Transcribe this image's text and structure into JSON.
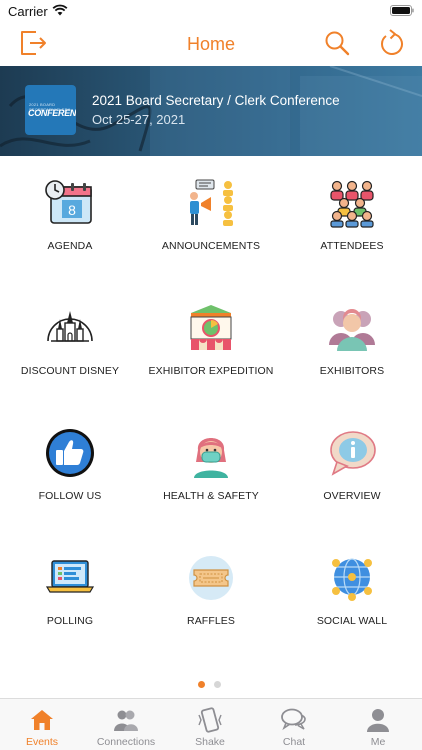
{
  "status_bar": {
    "carrier": "Carrier"
  },
  "nav": {
    "title": "Home"
  },
  "banner": {
    "logo_small": "2021 BOARD SECRETARY/CLERK",
    "logo_text": "CONFERENCE",
    "title": "2021 Board Secretary / Clerk Conference",
    "dates": "Oct 25-27, 2021"
  },
  "tiles": [
    {
      "label": "AGENDA",
      "icon": "calendar-clock-icon"
    },
    {
      "label": "ANNOUNCEMENTS",
      "icon": "megaphone-presenter-icon"
    },
    {
      "label": "ATTENDEES",
      "icon": "audience-group-icon"
    },
    {
      "label": "DISCOUNT DISNEY",
      "icon": "castle-icon"
    },
    {
      "label": "EXHIBITOR EXPEDITION",
      "icon": "carnival-booth-icon"
    },
    {
      "label": "EXHIBITORS",
      "icon": "people-group-icon"
    },
    {
      "label": "FOLLOW US",
      "icon": "thumbs-up-icon"
    },
    {
      "label": "HEALTH & SAFETY",
      "icon": "masked-person-icon"
    },
    {
      "label": "OVERVIEW",
      "icon": "info-bubble-icon"
    },
    {
      "label": "POLLING",
      "icon": "laptop-poll-icon"
    },
    {
      "label": "RAFFLES",
      "icon": "ticket-icon"
    },
    {
      "label": "SOCIAL WALL",
      "icon": "globe-network-icon"
    }
  ],
  "pagination": {
    "current": 1,
    "total": 2
  },
  "tabs": [
    {
      "label": "Events",
      "icon": "house-icon",
      "active": true
    },
    {
      "label": "Connections",
      "icon": "connections-icon",
      "active": false
    },
    {
      "label": "Shake",
      "icon": "shake-phone-icon",
      "active": false
    },
    {
      "label": "Chat",
      "icon": "chat-bubbles-icon",
      "active": false
    },
    {
      "label": "Me",
      "icon": "person-icon",
      "active": false
    }
  ],
  "colors": {
    "accent": "#f0812a",
    "inactive": "#8e8e93",
    "banner": "#2a5878"
  }
}
